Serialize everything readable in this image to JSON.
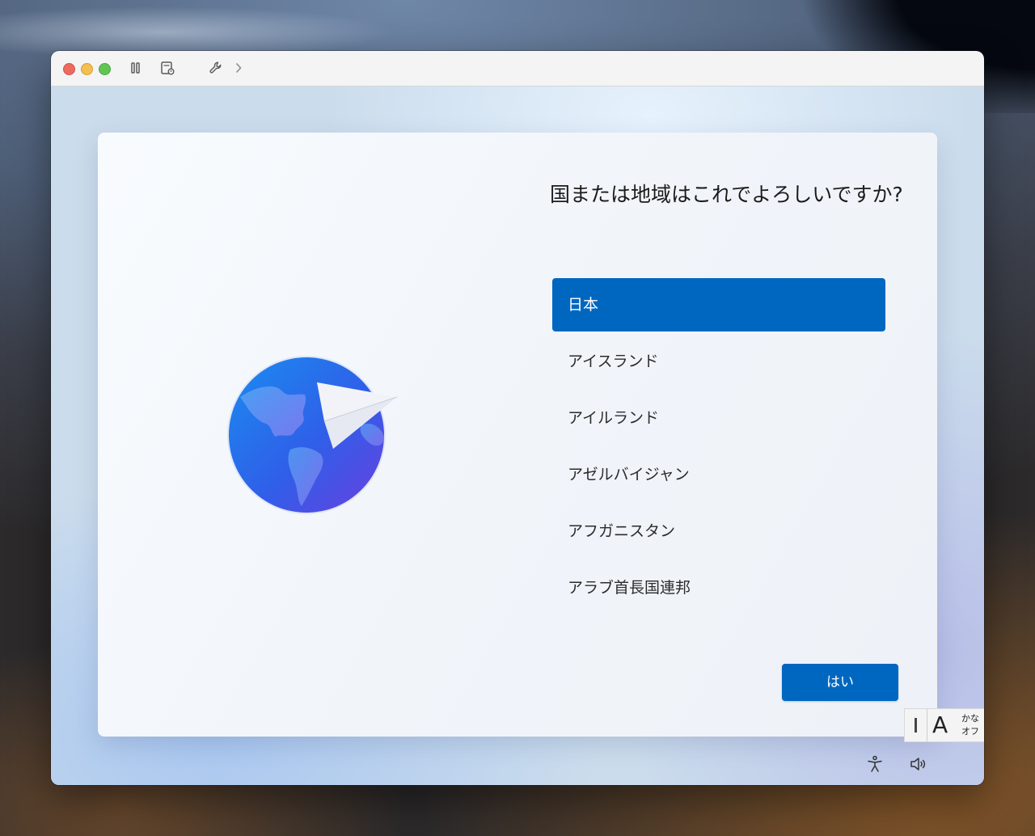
{
  "colors": {
    "accent": "#0067c0",
    "close": "#ed6a5e",
    "minimize": "#f4bf4f",
    "maximize": "#61c554"
  },
  "toolbar": {
    "icons": [
      "pause-icon",
      "snapshot-icon",
      "wrench-icon",
      "chevron-right-icon"
    ]
  },
  "setup": {
    "question": "国または地域はこれでよろしいですか?",
    "regions": [
      "日本",
      "アイスランド",
      "アイルランド",
      "アゼルバイジャン",
      "アフガニスタン",
      "アラブ首長国連邦"
    ],
    "selected_index": 0,
    "yes_label": "はい"
  },
  "ime": {
    "mode_letter": "A",
    "kana_line1": "かな",
    "kana_line2": "オフ"
  },
  "system_icons": [
    "accessibility-icon",
    "volume-icon"
  ]
}
